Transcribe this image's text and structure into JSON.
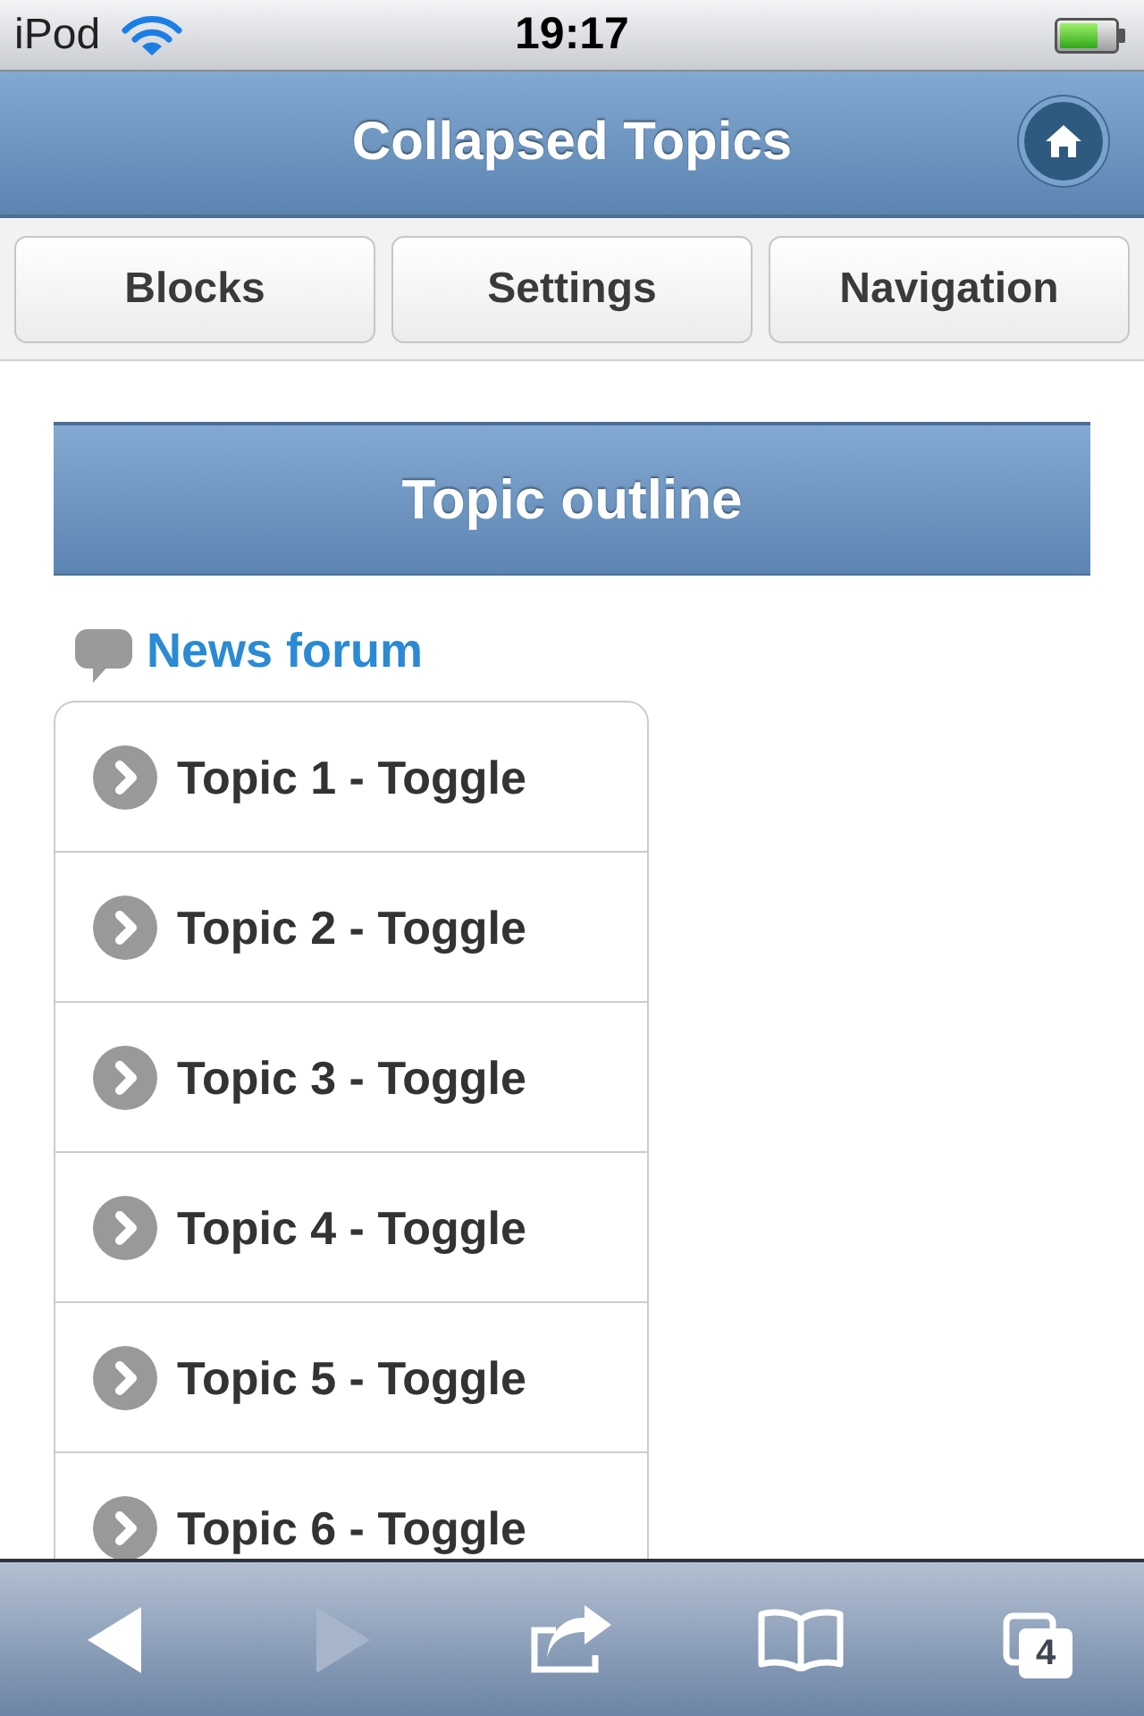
{
  "status_bar": {
    "carrier": "iPod",
    "time": "19:17"
  },
  "header": {
    "title": "Collapsed Topics"
  },
  "nav_buttons": [
    "Blocks",
    "Settings",
    "Navigation"
  ],
  "section": {
    "title": "Topic outline"
  },
  "forum_link": "News forum",
  "topics": [
    {
      "label": "Topic 1 - Toggle",
      "expanded": false
    },
    {
      "label": "Topic 2 - Toggle",
      "expanded": false
    },
    {
      "label": "Topic 3 - Toggle",
      "expanded": false
    },
    {
      "label": "Topic 4 - Toggle",
      "expanded": false
    },
    {
      "label": "Topic 5 - Toggle",
      "expanded": false
    },
    {
      "label": "Topic 6 - Toggle",
      "expanded": false
    }
  ],
  "toolbar": [
    {
      "kind": "back",
      "disabled": false
    },
    {
      "kind": "forward",
      "disabled": true
    },
    {
      "kind": "share",
      "disabled": false
    },
    {
      "kind": "bookmarks",
      "disabled": false
    },
    {
      "kind": "tabs",
      "disabled": false,
      "count": "4"
    }
  ]
}
